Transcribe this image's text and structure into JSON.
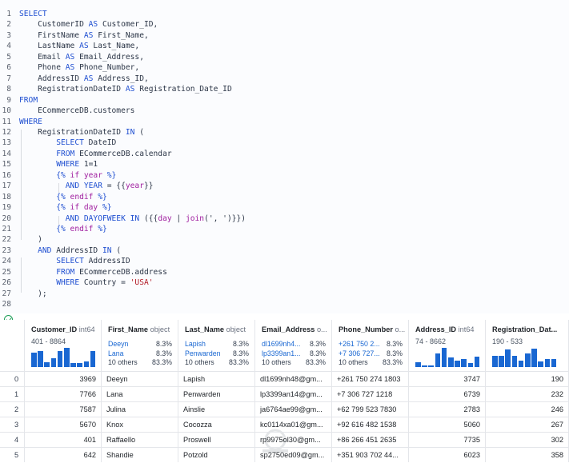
{
  "editor": {
    "lines": [
      {
        "n": "1",
        "segs": [
          {
            "t": "SELECT",
            "c": "kw"
          }
        ]
      },
      {
        "n": "2",
        "segs": [
          {
            "t": "    CustomerID "
          },
          {
            "t": "AS",
            "c": "kw"
          },
          {
            "t": " Customer_ID,"
          }
        ]
      },
      {
        "n": "3",
        "segs": [
          {
            "t": "    FirstName "
          },
          {
            "t": "AS",
            "c": "kw"
          },
          {
            "t": " First_Name,"
          }
        ]
      },
      {
        "n": "4",
        "segs": [
          {
            "t": "    LastName "
          },
          {
            "t": "AS",
            "c": "kw"
          },
          {
            "t": " Last_Name,"
          }
        ]
      },
      {
        "n": "5",
        "segs": [
          {
            "t": "    Email "
          },
          {
            "t": "AS",
            "c": "kw"
          },
          {
            "t": " Email_Address,"
          }
        ]
      },
      {
        "n": "6",
        "segs": [
          {
            "t": "    Phone "
          },
          {
            "t": "AS",
            "c": "kw"
          },
          {
            "t": " Phone_Number,"
          }
        ]
      },
      {
        "n": "7",
        "segs": [
          {
            "t": "    AddressID "
          },
          {
            "t": "AS",
            "c": "kw"
          },
          {
            "t": " Address_ID,"
          }
        ]
      },
      {
        "n": "8",
        "segs": [
          {
            "t": "    RegistrationDateID "
          },
          {
            "t": "AS",
            "c": "kw"
          },
          {
            "t": " Registration_Date_ID"
          }
        ]
      },
      {
        "n": "9",
        "segs": [
          {
            "t": "FROM",
            "c": "kw"
          }
        ]
      },
      {
        "n": "10",
        "segs": [
          {
            "t": "    ECommerceDB.customers"
          }
        ]
      },
      {
        "n": "11",
        "segs": [
          {
            "t": "WHERE",
            "c": "kw"
          }
        ]
      },
      {
        "n": "12",
        "segs": [
          {
            "t": "    RegistrationDateID "
          },
          {
            "t": "IN",
            "c": "kw"
          },
          {
            "t": " ("
          }
        ]
      },
      {
        "n": "13",
        "segs": [
          {
            "t": "        "
          },
          {
            "t": "SELECT",
            "c": "kw"
          },
          {
            "t": " DateID"
          }
        ]
      },
      {
        "n": "14",
        "segs": [
          {
            "t": "        "
          },
          {
            "t": "FROM",
            "c": "kw"
          },
          {
            "t": " ECommerceDB.calendar"
          }
        ]
      },
      {
        "n": "15",
        "segs": [
          {
            "t": "        "
          },
          {
            "t": "WHERE",
            "c": "kw"
          },
          {
            "t": " 1=1"
          }
        ]
      },
      {
        "n": "16",
        "segs": [
          {
            "t": "        "
          },
          {
            "t": "{% ",
            "c": "kw"
          },
          {
            "t": "if",
            "c": "tp"
          },
          {
            "t": " year ",
            "c": "tp"
          },
          {
            "t": "%}",
            "c": "kw"
          }
        ]
      },
      {
        "n": "17",
        "segs": [
          {
            "t": "          "
          },
          {
            "t": "AND",
            "c": "kw"
          },
          {
            "t": " "
          },
          {
            "t": "YEAR",
            "c": "kw"
          },
          {
            "t": " = {{"
          },
          {
            "t": "year",
            "c": "tp"
          },
          {
            "t": "}}"
          }
        ]
      },
      {
        "n": "18",
        "segs": [
          {
            "t": "        "
          },
          {
            "t": "{% ",
            "c": "kw"
          },
          {
            "t": "endif",
            "c": "tp"
          },
          {
            "t": " %}",
            "c": "kw"
          }
        ]
      },
      {
        "n": "19",
        "segs": [
          {
            "t": "        "
          },
          {
            "t": "{% ",
            "c": "kw"
          },
          {
            "t": "if",
            "c": "tp"
          },
          {
            "t": " day ",
            "c": "tp"
          },
          {
            "t": "%}",
            "c": "kw"
          }
        ]
      },
      {
        "n": "20",
        "segs": [
          {
            "t": "          "
          },
          {
            "t": "AND",
            "c": "kw"
          },
          {
            "t": " "
          },
          {
            "t": "DAYOFWEEK",
            "c": "kw"
          },
          {
            "t": " "
          },
          {
            "t": "IN",
            "c": "kw"
          },
          {
            "t": " ({{"
          },
          {
            "t": "day",
            "c": "tp"
          },
          {
            "t": " | "
          },
          {
            "t": "join",
            "c": "tp"
          },
          {
            "t": "(', ')}})"
          }
        ]
      },
      {
        "n": "21",
        "segs": [
          {
            "t": "        "
          },
          {
            "t": "{% ",
            "c": "kw"
          },
          {
            "t": "endif",
            "c": "tp"
          },
          {
            "t": " %}",
            "c": "kw"
          }
        ]
      },
      {
        "n": "22",
        "segs": [
          {
            "t": "    )"
          }
        ]
      },
      {
        "n": "23",
        "segs": [
          {
            "t": "    "
          },
          {
            "t": "AND",
            "c": "kw"
          },
          {
            "t": " AddressID "
          },
          {
            "t": "IN",
            "c": "kw"
          },
          {
            "t": " ("
          }
        ]
      },
      {
        "n": "24",
        "segs": [
          {
            "t": "        "
          },
          {
            "t": "SELECT",
            "c": "kw"
          },
          {
            "t": " AddressID"
          }
        ]
      },
      {
        "n": "25",
        "segs": [
          {
            "t": "        "
          },
          {
            "t": "FROM",
            "c": "kw"
          },
          {
            "t": " ECommerceDB.address"
          }
        ]
      },
      {
        "n": "26",
        "segs": [
          {
            "t": "        "
          },
          {
            "t": "WHERE",
            "c": "kw"
          },
          {
            "t": " Country = "
          },
          {
            "t": "'USA'",
            "c": "st"
          }
        ]
      },
      {
        "n": "27",
        "segs": [
          {
            "t": "    );"
          }
        ]
      },
      {
        "n": "28",
        "segs": []
      }
    ]
  },
  "status": {
    "icon": "check-circle-icon",
    "color": "#1e9e58"
  },
  "accent": "#1967d2",
  "columns": [
    {
      "key": "idx",
      "label": "",
      "dtype": ""
    },
    {
      "key": "Customer_ID",
      "label": "Customer_ID",
      "dtype": "int64",
      "range": "401 - 8864",
      "hist": [
        0.75,
        0.85,
        0.25,
        0.45,
        0.85,
        1.0,
        0.2,
        0.2,
        0.3,
        0.85
      ]
    },
    {
      "key": "First_Name",
      "label": "First_Name",
      "dtype": "object",
      "cats": [
        {
          "v": "Deeyn",
          "p": "8.3%"
        },
        {
          "v": "Lana",
          "p": "8.3%"
        },
        {
          "v": "10 others",
          "p": "83.3%",
          "other": true
        }
      ]
    },
    {
      "key": "Last_Name",
      "label": "Last_Name",
      "dtype": "object",
      "cats": [
        {
          "v": "Lapish",
          "p": "8.3%"
        },
        {
          "v": "Penwarden",
          "p": "8.3%"
        },
        {
          "v": "10 others",
          "p": "83.3%",
          "other": true
        }
      ]
    },
    {
      "key": "Email_Address",
      "label": "Email_Address",
      "dtype": "o...",
      "cats": [
        {
          "v": "dl1699nh4...",
          "p": "8.3%"
        },
        {
          "v": "lp3399an1...",
          "p": "8.3%"
        },
        {
          "v": "10 others",
          "p": "83.3%",
          "other": true
        }
      ]
    },
    {
      "key": "Phone_Number",
      "label": "Phone_Number",
      "dtype": "o...",
      "cats": [
        {
          "v": "+261 750 2...",
          "p": "8.3%"
        },
        {
          "v": "+7 306 727...",
          "p": "8.3%"
        },
        {
          "v": "10 others",
          "p": "83.3%",
          "other": true
        }
      ]
    },
    {
      "key": "Address_ID",
      "label": "Address_ID",
      "dtype": "int64",
      "range": "74 - 8662",
      "hist": [
        0.25,
        0.1,
        0.1,
        0.7,
        1.0,
        0.5,
        0.35,
        0.4,
        0.2,
        0.55
      ]
    },
    {
      "key": "Registration_Date",
      "label": "Registration_Dat...",
      "dtype": "",
      "range": "190 - 533",
      "hist": [
        0.6,
        0.6,
        0.9,
        0.6,
        0.35,
        0.7,
        0.95,
        0.3,
        0.4,
        0.4
      ]
    }
  ],
  "rows": [
    [
      "0",
      "3969",
      "Deeyn",
      "Lapish",
      "dl1699nh48@gm...",
      "+261 750 274 1803",
      "3747",
      "190"
    ],
    [
      "1",
      "7766",
      "Lana",
      "Penwarden",
      "lp3399an14@gm...",
      "+7 306 727 1218",
      "6739",
      "232"
    ],
    [
      "2",
      "7587",
      "Julina",
      "Ainslie",
      "ja6764ae99@gm...",
      "+62 799 523 7830",
      "2783",
      "246"
    ],
    [
      "3",
      "5670",
      "Knox",
      "Cocozza",
      "kc0114xa01@gm...",
      "+92 616 482 1538",
      "5060",
      "267"
    ],
    [
      "4",
      "401",
      "Raffaello",
      "Proswell",
      "rp9975ol30@gm...",
      "+86 266 451 2635",
      "7735",
      "302"
    ],
    [
      "5",
      "642",
      "Shandie",
      "Potzold",
      "sp2750ed09@gm...",
      "+351 903 702 44...",
      "6023",
      "358"
    ]
  ]
}
